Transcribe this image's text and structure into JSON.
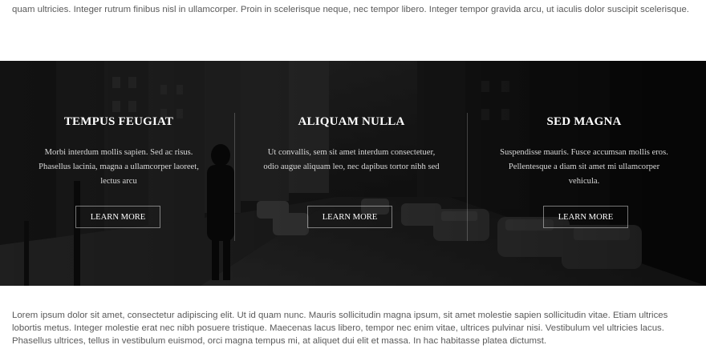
{
  "intro_text": "quam ultricies. Integer rutrum finibus nisl in ullamcorper. Proin in scelerisque neque, nec tempor libero. Integer tempor gravida arcu, ut iaculis dolor suscipit scelerisque.",
  "features": [
    {
      "title": "TEMPUS FEUGIAT",
      "text": "Morbi interdum mollis sapien. Sed ac risus. Phasellus lacinia, magna a ullamcorper laoreet, lectus arcu",
      "button_label": "LEARN MORE"
    },
    {
      "title": "ALIQUAM NULLA",
      "text": "Ut convallis, sem sit amet interdum consectetuer, odio augue aliquam leo, nec dapibus tortor nibh sed",
      "button_label": "LEARN MORE"
    },
    {
      "title": "SED MAGNA",
      "text": "Suspendisse mauris. Fusce accumsan mollis eros. Pellentesque a diam sit amet mi ullamcorper vehicula.",
      "button_label": "LEARN MORE"
    }
  ],
  "outro_text": "Lorem ipsum dolor sit amet, consectetur adipiscing elit. Ut id quam nunc. Mauris sollicitudin magna ipsum, sit amet molestie sapien sollicitudin vitae. Etiam ultrices lobortis metus. Integer molestie erat nec nibh posuere tristique. Maecenas lacus libero, tempor nec enim vitae, ultrices pulvinar nisi. Vestibulum vel ultricies lacus. Phasellus ultrices, tellus in vestibulum euismod, orci magna tempus mi, at aliquet dui elit et massa. In hac habitasse platea dictumst.",
  "colors": {
    "banner_base": "#141414",
    "text_muted": "#5a5a5a",
    "heading_on_dark": "#ffffff"
  },
  "background_image": "city-street-photo"
}
